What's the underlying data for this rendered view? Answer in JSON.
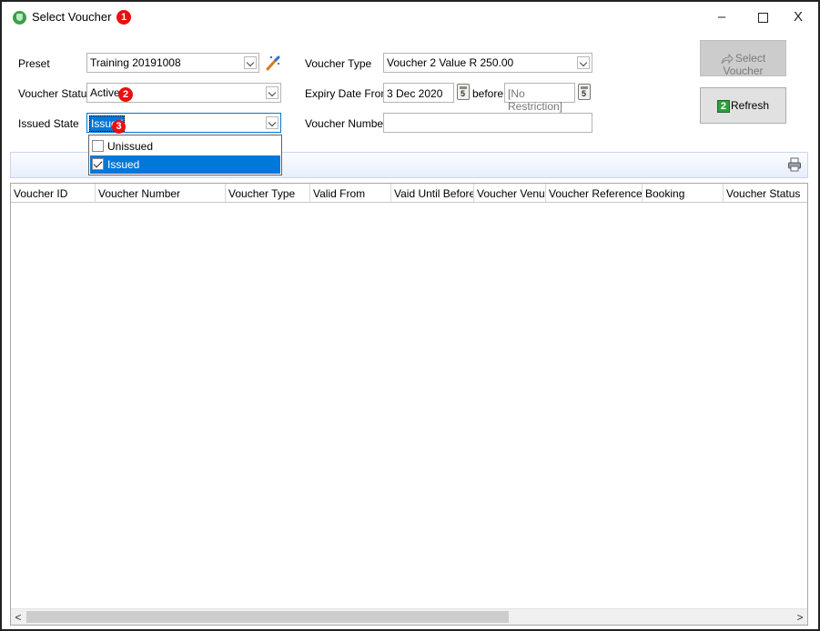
{
  "window": {
    "title": "Select Voucher",
    "controls": {
      "minimize": "–",
      "close": "X"
    }
  },
  "badges": [
    "1",
    "2",
    "3"
  ],
  "form": {
    "preset": {
      "label": "Preset",
      "value": "Training 20191008"
    },
    "voucher_status": {
      "label": "Voucher Status",
      "value": "Active"
    },
    "issued_state": {
      "label": "Issued State",
      "value": "Issued",
      "options": [
        {
          "label": "Unissued",
          "checked": false
        },
        {
          "label": "Issued",
          "checked": true
        }
      ]
    },
    "voucher_type": {
      "label": "Voucher Type",
      "value": "Voucher 2 Value R 250.00"
    },
    "expiry_date_from": {
      "label": "Expiry Date From",
      "value": "3 Dec 2020"
    },
    "before": {
      "label": "before",
      "value": "[No Restriction]"
    },
    "voucher_number": {
      "label": "Voucher Number",
      "value": ""
    }
  },
  "buttons": {
    "select_voucher": "Select Voucher",
    "refresh": "Refresh"
  },
  "grid": {
    "columns": [
      "Voucher ID",
      "Voucher Number",
      "Voucher Type",
      "Valid From",
      "Vaid Until Before",
      "Voucher Venue",
      "Voucher Reference",
      "Booking",
      "Voucher Status"
    ],
    "scroll": {
      "left_arrow": "<",
      "right_arrow": ">"
    }
  },
  "icons": {
    "app": "voucher-app-icon",
    "preset_action": "magic-wand-icon",
    "calendar": "calendar-icon",
    "print": "print-icon",
    "refresh": "refresh-icon",
    "select": "share-arrow-icon"
  },
  "colors": {
    "selection": "#0078d7",
    "badge": "#e81010",
    "app_icon": "#3aa04a"
  }
}
